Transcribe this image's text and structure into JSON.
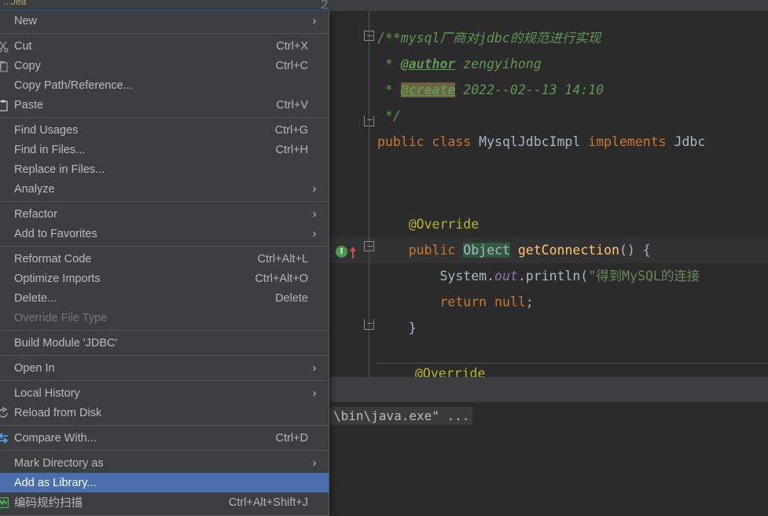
{
  "window": {
    "tab_label_partial": "...Jea",
    "corner_glyph": "2"
  },
  "context_menu": {
    "items": [
      {
        "label": "New",
        "shortcut": "",
        "icon": "",
        "submenu": true,
        "selected": false,
        "disabled": false,
        "sep_after": true
      },
      {
        "label": "Cut",
        "shortcut": "Ctrl+X",
        "icon": "cut-icon",
        "submenu": false,
        "selected": false,
        "disabled": false,
        "sep_after": false
      },
      {
        "label": "Copy",
        "shortcut": "Ctrl+C",
        "icon": "copy-icon",
        "submenu": false,
        "selected": false,
        "disabled": false,
        "sep_after": false
      },
      {
        "label": "Copy Path/Reference...",
        "shortcut": "",
        "icon": "",
        "submenu": false,
        "selected": false,
        "disabled": false,
        "sep_after": false
      },
      {
        "label": "Paste",
        "shortcut": "Ctrl+V",
        "icon": "paste-icon",
        "submenu": false,
        "selected": false,
        "disabled": false,
        "sep_after": true
      },
      {
        "label": "Find Usages",
        "shortcut": "Ctrl+G",
        "icon": "",
        "submenu": false,
        "selected": false,
        "disabled": false,
        "sep_after": false
      },
      {
        "label": "Find in Files...",
        "shortcut": "Ctrl+H",
        "icon": "",
        "submenu": false,
        "selected": false,
        "disabled": false,
        "sep_after": false
      },
      {
        "label": "Replace in Files...",
        "shortcut": "",
        "icon": "",
        "submenu": false,
        "selected": false,
        "disabled": false,
        "sep_after": false
      },
      {
        "label": "Analyze",
        "shortcut": "",
        "icon": "",
        "submenu": true,
        "selected": false,
        "disabled": false,
        "sep_after": true
      },
      {
        "label": "Refactor",
        "shortcut": "",
        "icon": "",
        "submenu": true,
        "selected": false,
        "disabled": false,
        "sep_after": false
      },
      {
        "label": "Add to Favorites",
        "shortcut": "",
        "icon": "",
        "submenu": true,
        "selected": false,
        "disabled": false,
        "sep_after": true
      },
      {
        "label": "Reformat Code",
        "shortcut": "Ctrl+Alt+L",
        "icon": "",
        "submenu": false,
        "selected": false,
        "disabled": false,
        "sep_after": false
      },
      {
        "label": "Optimize Imports",
        "shortcut": "Ctrl+Alt+O",
        "icon": "",
        "submenu": false,
        "selected": false,
        "disabled": false,
        "sep_after": false
      },
      {
        "label": "Delete...",
        "shortcut": "Delete",
        "icon": "",
        "submenu": false,
        "selected": false,
        "disabled": false,
        "sep_after": false
      },
      {
        "label": "Override File Type",
        "shortcut": "",
        "icon": "",
        "submenu": false,
        "selected": false,
        "disabled": true,
        "sep_after": true
      },
      {
        "label": "Build Module 'JDBC'",
        "shortcut": "",
        "icon": "",
        "submenu": false,
        "selected": false,
        "disabled": false,
        "sep_after": true
      },
      {
        "label": "Open In",
        "shortcut": "",
        "icon": "",
        "submenu": true,
        "selected": false,
        "disabled": false,
        "sep_after": true
      },
      {
        "label": "Local History",
        "shortcut": "",
        "icon": "",
        "submenu": true,
        "selected": false,
        "disabled": false,
        "sep_after": false
      },
      {
        "label": "Reload from Disk",
        "shortcut": "",
        "icon": "reload-icon",
        "submenu": false,
        "selected": false,
        "disabled": false,
        "sep_after": true
      },
      {
        "label": "Compare With...",
        "shortcut": "Ctrl+D",
        "icon": "compare-icon",
        "submenu": false,
        "selected": false,
        "disabled": false,
        "sep_after": true
      },
      {
        "label": "Mark Directory as",
        "shortcut": "",
        "icon": "",
        "submenu": true,
        "selected": false,
        "disabled": false,
        "sep_after": false
      },
      {
        "label": "Add as Library...",
        "shortcut": "",
        "icon": "",
        "submenu": false,
        "selected": true,
        "disabled": false,
        "sep_after": false
      },
      {
        "label": "编码规约扫描",
        "shortcut": "Ctrl+Alt+Shift+J",
        "icon": "scan-icon",
        "submenu": false,
        "selected": false,
        "disabled": false,
        "sep_after": false
      }
    ],
    "colors": {
      "background": "#3c3f41",
      "selection": "#4b6eaf",
      "text": "#bbbbbb",
      "disabled_text": "#777777",
      "separator": "#515455"
    }
  },
  "editor": {
    "lines": [
      {
        "id": "l1",
        "segments": [
          {
            "t": "/**mysql厂商对jdbc的规范进行实现",
            "c": "cmt"
          }
        ]
      },
      {
        "id": "l2",
        "segments": [
          {
            "t": " * ",
            "c": "cmt"
          },
          {
            "t": "@author",
            "c": "cmt-tag"
          },
          {
            "t": " zengyihong",
            "c": "cmt"
          }
        ]
      },
      {
        "id": "l3",
        "segments": [
          {
            "t": " * ",
            "c": "cmt"
          },
          {
            "t": "@create",
            "c": "cmt-hl"
          },
          {
            "t": " 2022--02--13 14:10",
            "c": "cmt"
          }
        ]
      },
      {
        "id": "l4",
        "segments": [
          {
            "t": " */",
            "c": "cmt"
          }
        ]
      },
      {
        "id": "l5",
        "segments": [
          {
            "t": "public",
            "c": "kw"
          },
          {
            "t": " ",
            "c": "ident"
          },
          {
            "t": "class",
            "c": "kw"
          },
          {
            "t": " MysqlJdbcImpl ",
            "c": "ident"
          },
          {
            "t": "implements",
            "c": "kw"
          },
          {
            "t": " Jdbc",
            "c": "ident"
          }
        ]
      },
      {
        "id": "l6",
        "segments": [
          {
            "t": "    @Override",
            "c": "anno"
          }
        ]
      },
      {
        "id": "l7",
        "segments": [
          {
            "t": "    ",
            "c": "ident"
          },
          {
            "t": "public",
            "c": "kw"
          },
          {
            "t": " ",
            "c": "ident"
          },
          {
            "t": "Object",
            "c": "type-hl"
          },
          {
            "t": " ",
            "c": "ident"
          },
          {
            "t": "getConnection",
            "c": "method"
          },
          {
            "t": "() {",
            "c": "punct"
          }
        ]
      },
      {
        "id": "l8",
        "segments": [
          {
            "t": "        System.",
            "c": "ident"
          },
          {
            "t": "out",
            "c": "field-it"
          },
          {
            "t": ".println(",
            "c": "ident"
          },
          {
            "t": "\"得到MySQL的连接",
            "c": "str"
          }
        ]
      },
      {
        "id": "l9",
        "segments": [
          {
            "t": "        ",
            "c": "ident"
          },
          {
            "t": "return",
            "c": "kw"
          },
          {
            "t": " ",
            "c": "ident"
          },
          {
            "t": "null",
            "c": "kw"
          },
          {
            "t": ";",
            "c": "punct"
          }
        ]
      },
      {
        "id": "l10",
        "segments": [
          {
            "t": "    }",
            "c": "brace"
          }
        ]
      }
    ],
    "peek_text": "@Override",
    "gutter_marker_letter": "I",
    "colors": {
      "background": "#2b2b2b",
      "caret_line": "#323232",
      "keyword": "#cc7832",
      "comment": "#629755",
      "string": "#6a8759",
      "annotation": "#bbb529",
      "method": "#ffc66d",
      "identifier": "#a9b7c6",
      "field_italic": "#9876aa",
      "marker_green": "#499c54",
      "marker_red": "#c75450"
    }
  },
  "console": {
    "text": "\\bin\\java.exe\" ..."
  }
}
